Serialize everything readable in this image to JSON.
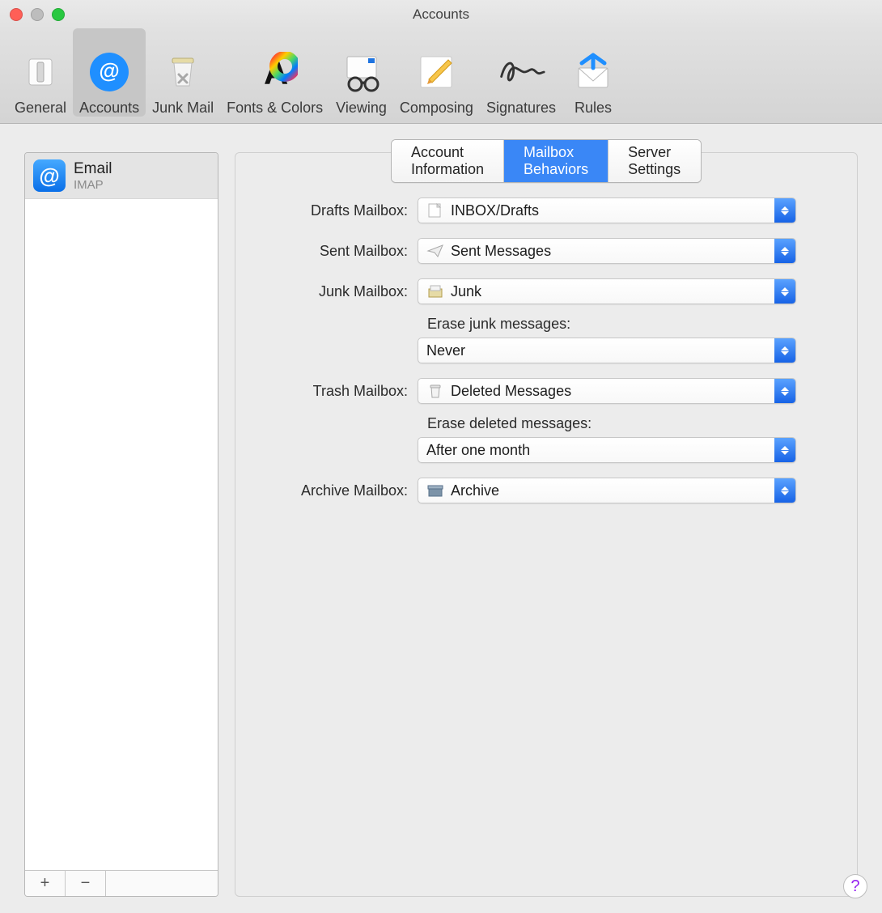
{
  "window": {
    "title": "Accounts"
  },
  "toolbar": {
    "items": [
      {
        "id": "general",
        "label": "General"
      },
      {
        "id": "accounts",
        "label": "Accounts"
      },
      {
        "id": "junk",
        "label": "Junk Mail"
      },
      {
        "id": "fonts",
        "label": "Fonts & Colors"
      },
      {
        "id": "viewing",
        "label": "Viewing"
      },
      {
        "id": "composing",
        "label": "Composing"
      },
      {
        "id": "signatures",
        "label": "Signatures"
      },
      {
        "id": "rules",
        "label": "Rules"
      }
    ],
    "active": "accounts"
  },
  "sidebar": {
    "accounts": [
      {
        "name": "Email",
        "subtitle": "IMAP"
      }
    ],
    "add": "+",
    "remove": "−"
  },
  "tabs": {
    "items": [
      {
        "id": "account_info",
        "label": "Account Information"
      },
      {
        "id": "mailbox",
        "label": "Mailbox Behaviors"
      },
      {
        "id": "server_settings",
        "label": "Server Settings"
      }
    ],
    "active": "mailbox"
  },
  "form": {
    "drafts": {
      "label": "Drafts Mailbox:",
      "value": "INBOX/Drafts"
    },
    "sent": {
      "label": "Sent Mailbox:",
      "value": "Sent Messages"
    },
    "junk": {
      "label": "Junk Mailbox:",
      "value": "Junk"
    },
    "erase_junk": {
      "label": "Erase junk messages:",
      "value": "Never"
    },
    "trash": {
      "label": "Trash Mailbox:",
      "value": "Deleted Messages"
    },
    "erase_trash": {
      "label": "Erase deleted messages:",
      "value": "After one month"
    },
    "archive": {
      "label": "Archive Mailbox:",
      "value": "Archive"
    }
  },
  "help": "?"
}
